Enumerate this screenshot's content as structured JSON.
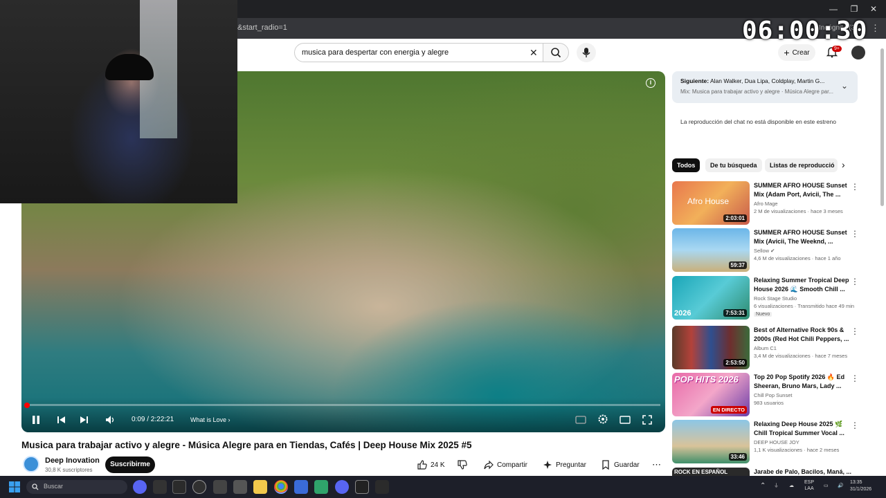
{
  "browser": {
    "url": "&start_radio=1",
    "incognito_label": "Incógnito (3)",
    "clock": "06:00:30"
  },
  "header": {
    "search_value": "musica para despertar con energia y alegre",
    "create_label": "Crear",
    "notifications_badge": "9+"
  },
  "player": {
    "time": "0:09 / 2:22:21",
    "chapter": "What is Love",
    "progress": 0.0011,
    "info_icon": "i"
  },
  "video": {
    "title": "Musica para trabajar activo y alegre - Música Alegre para en Tiendas, Cafés | Deep House Mix 2025 #5",
    "channel": "Deep Inovation",
    "subscribers": "30,8 K suscriptores",
    "subscribe_label": "Suscribirme",
    "likes": "24 K",
    "share_label": "Compartir",
    "ask_label": "Preguntar",
    "save_label": "Guardar"
  },
  "up_next": {
    "line1_label": "Siguiente:",
    "line1_value": "Alan Walker, Dua Lipa, Coldplay, Martin G...",
    "line2": "Mix: Musica para trabajar activo y alegre · Música Alegre par..."
  },
  "chat_message": "La reproducción del chat no está disponible en este estreno",
  "chips": [
    "Todos",
    "De tu búsqueda",
    "Listas de reproducció"
  ],
  "recommendations": [
    {
      "title": "SUMMER AFRO HOUSE Sunset Mix (Adam Port, Avicii, The ...",
      "channel": "Afro Mage",
      "meta": "2 M de visualizaciones · hace 3 meses",
      "duration": "2:03:01",
      "thumb_text": "Afro House"
    },
    {
      "title": "SUMMER AFRO HOUSE Sunset Mix (Avicii, The Weeknd, ...",
      "channel": "Sellow ✔",
      "meta": "4,6 M de visualizaciones · hace 1 año",
      "duration": "59:37"
    },
    {
      "title": "Relaxing Summer Tropical Deep House 2026 🌊 Smooth Chill ...",
      "channel": "Rock Stage Studio",
      "meta": "6 visualizaciones · Transmitido hace 49 min",
      "duration": "7:53:31",
      "badge": "Nuevo",
      "thumb_text": "2026"
    },
    {
      "title": "Best of Alternative Rock 90s & 2000s (Red Hot Chili Peppers, ...",
      "channel": "Album C1",
      "meta": "3,4 M de visualizaciones · hace 7 meses",
      "duration": "2:53:50"
    },
    {
      "title": "Top 20 Pop Spotify 2026 🔥 Ed Sheeran, Bruno Mars, Lady ...",
      "channel": "Chill Pop Sunset",
      "meta": "983 usuarios",
      "live_label": "EN DIRECTO",
      "thumb_text": "POP HITS 2026"
    },
    {
      "title": "Relaxing Deep House 2025 🌿 Chill Tropical Summer Vocal ...",
      "channel": "DEEP HOUSE JOY",
      "meta": "1,1 K visualizaciones · hace 2 meses",
      "duration": "33:46"
    },
    {
      "title": "Jarabe de Palo, Bacilos, Maná, ...",
      "thumb_text": "ROCK EN ESPAÑOL"
    }
  ],
  "taskbar": {
    "search_placeholder": "Buscar",
    "lang": "ESP\nLAA",
    "time": "13:35",
    "date": "31/1/2026"
  },
  "colors": {
    "youtube_red": "#ff0000",
    "subscribe_bg": "#0f0f0f",
    "taskbar_bg": "#1d1f29",
    "up_next_bg": "#e9eef3"
  },
  "icons": [
    "search-icon",
    "mic-icon",
    "bell-icon",
    "pause-icon",
    "prev-icon",
    "next-icon",
    "volume-icon",
    "settings-icon",
    "fullscreen-icon",
    "like-icon",
    "dislike-icon",
    "share-icon",
    "ask-icon",
    "save-icon",
    "chevron-down-icon"
  ]
}
